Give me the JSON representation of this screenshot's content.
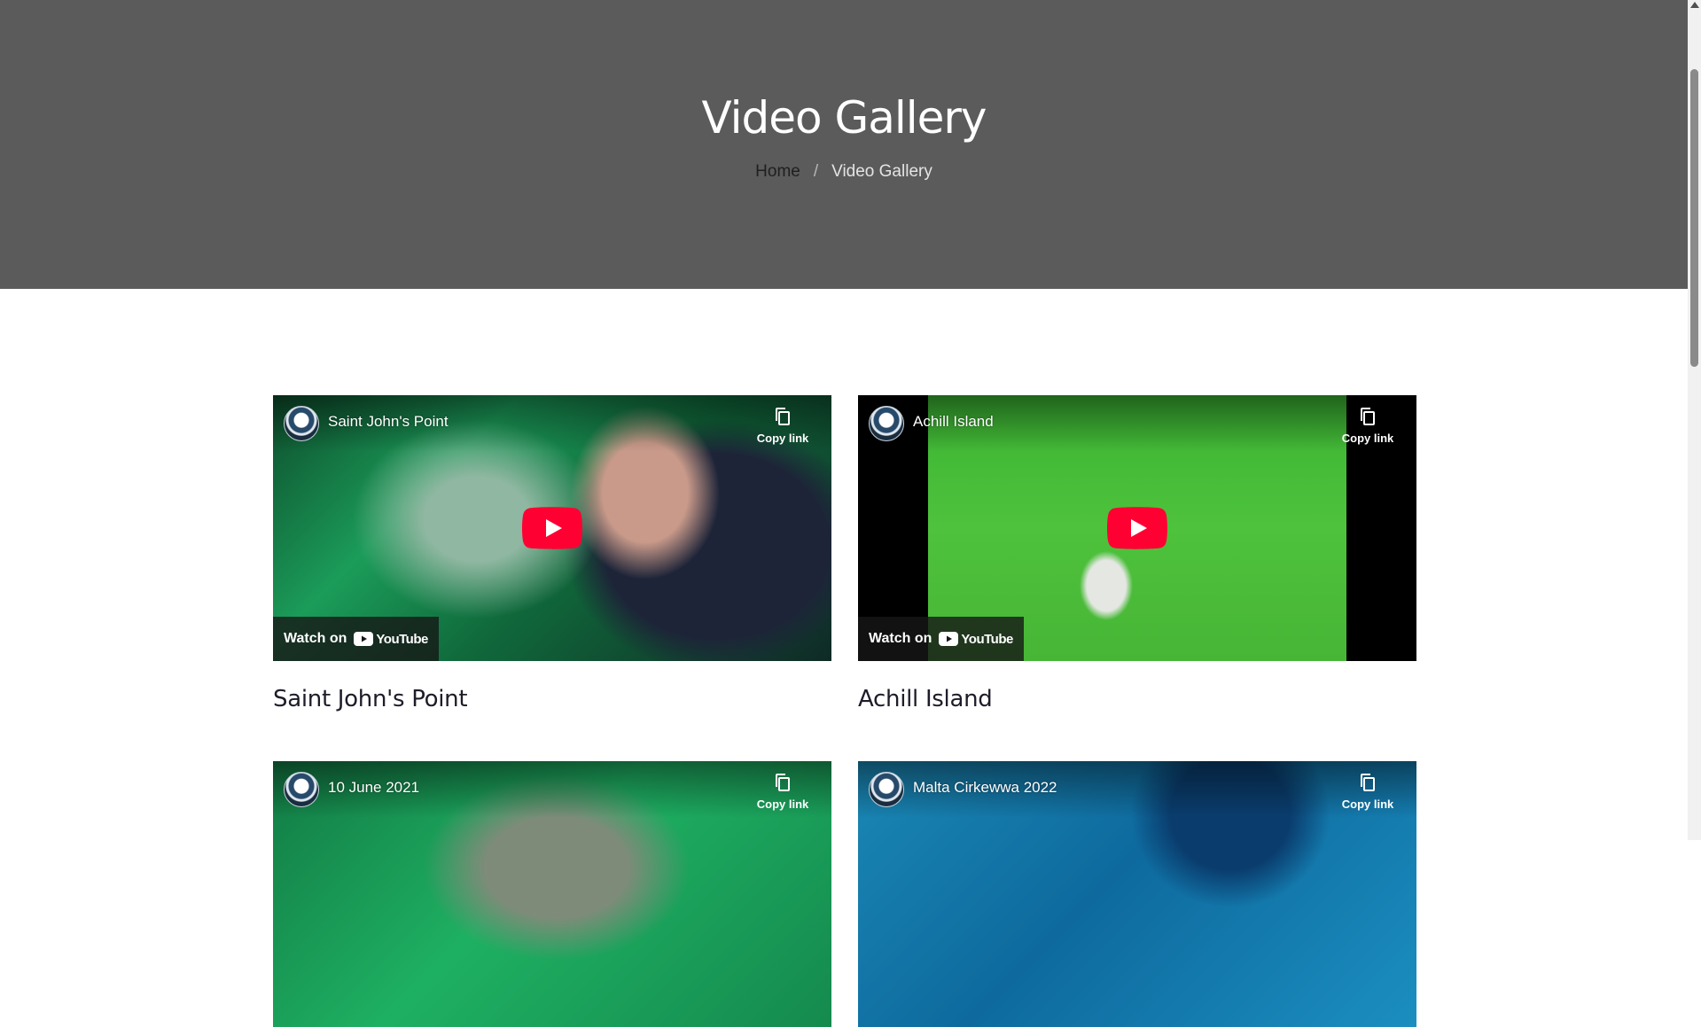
{
  "header": {
    "title": "Video Gallery",
    "breadcrumb": {
      "home": "Home",
      "separator": "/",
      "current": "Video Gallery"
    }
  },
  "videos": [
    {
      "title": "Saint John's Point",
      "overlay_title": "Saint John's Point",
      "copy_link": "Copy link",
      "watch_on": "Watch on",
      "youtube": "YouTube"
    },
    {
      "title": "Achill Island",
      "overlay_title": "Achill Island",
      "copy_link": "Copy link",
      "watch_on": "Watch on",
      "youtube": "YouTube"
    },
    {
      "overlay_title": "10 June 2021",
      "copy_link": "Copy link"
    },
    {
      "overlay_title": "Malta Cirkewwa 2022",
      "copy_link": "Copy link"
    }
  ],
  "colors": {
    "hero_background": "#5b5b5b",
    "youtube_red": "#ff0033"
  },
  "icons": {
    "play": "youtube-play-icon",
    "copy": "copy-icon",
    "youtube": "youtube-logo-icon"
  }
}
